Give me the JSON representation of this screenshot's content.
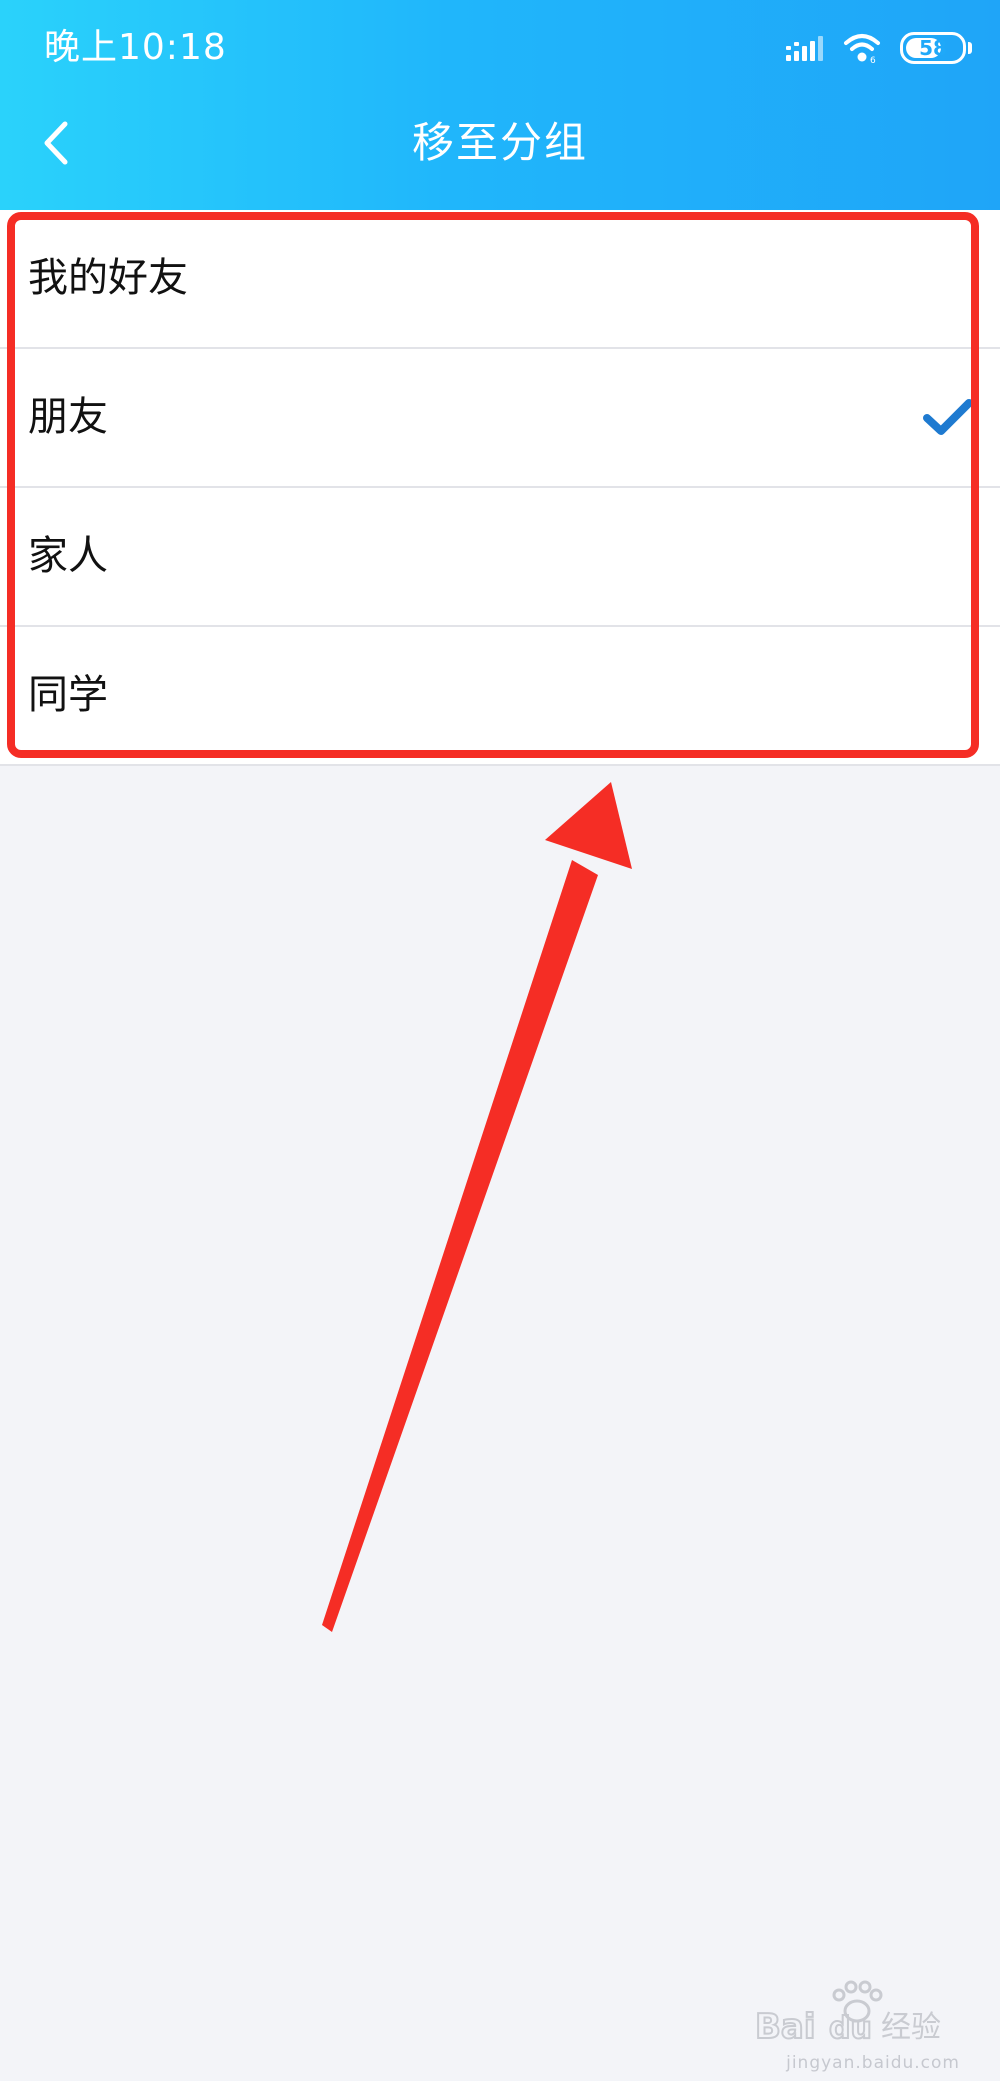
{
  "status_bar": {
    "time": "晚上10:18",
    "battery_level": "58",
    "icons": [
      "signal-icon",
      "wifi-icon",
      "battery-icon"
    ]
  },
  "nav_bar": {
    "title": "移至分组",
    "back_icon": "chevron-left-icon"
  },
  "groups": [
    {
      "label": "我的好友",
      "selected": false
    },
    {
      "label": "朋友",
      "selected": true
    },
    {
      "label": "家人",
      "selected": false
    },
    {
      "label": "同学",
      "selected": false
    }
  ],
  "colors": {
    "header_gradient_start": "#2ad2fb",
    "header_gradient_end": "#1fa5f8",
    "check": "#1e7ad0",
    "annotation_red": "#f52d25",
    "page_background": "#f3f4f8"
  },
  "watermark": {
    "brand": "Bai du 经验",
    "domain": "jingyan.baidu.com"
  }
}
